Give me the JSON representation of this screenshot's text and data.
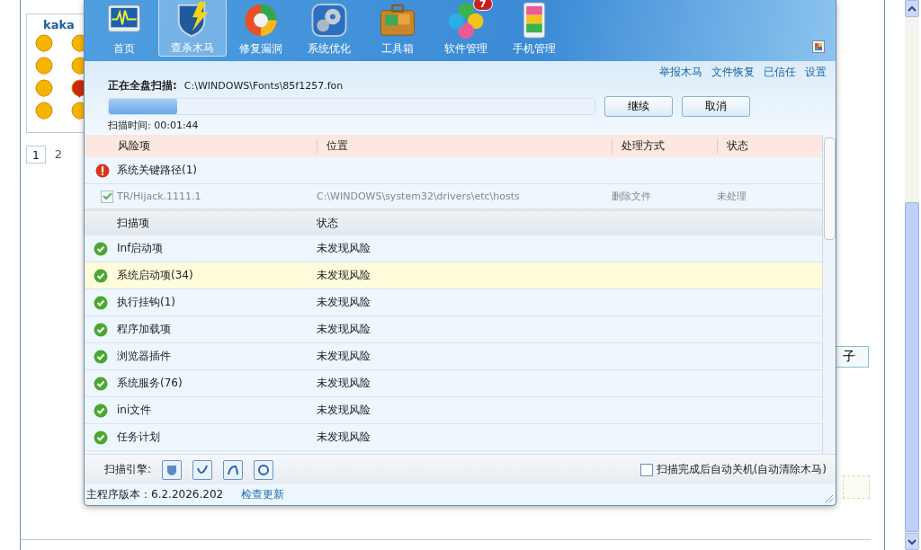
{
  "page": {
    "panel_title": "kaka",
    "pagination": [
      {
        "label": "1",
        "selected": true
      },
      {
        "label": "2",
        "selected": false
      }
    ],
    "side_button": "子"
  },
  "app": {
    "nav": [
      {
        "label": "首页",
        "selected": false
      },
      {
        "label": "查杀木马",
        "selected": true
      },
      {
        "label": "修复漏洞",
        "selected": false
      },
      {
        "label": "系统优化",
        "selected": false
      },
      {
        "label": "工具箱",
        "selected": false
      },
      {
        "label": "软件管理",
        "selected": false,
        "badge": "7"
      },
      {
        "label": "手机管理",
        "selected": false
      }
    ],
    "links": [
      "举报木马",
      "文件恢复",
      "已信任",
      "设置"
    ],
    "scan": {
      "label": "正在全盘扫描:",
      "path": "C:\\WINDOWS\\Fonts\\85f1257.fon",
      "level": 0.14,
      "time": "扫描时间: 00:01:44"
    },
    "buttons": [
      "继续",
      "取消"
    ],
    "risk_table": {
      "columns": [
        "风险项",
        "位置",
        "处理方式",
        "状态"
      ],
      "groups": [
        {
          "name": "系统关键路径(1)",
          "kind": "risk",
          "items": [
            {
              "name": "TR/Hijack.1111.1",
              "checked": true,
              "location": "C:\\WINDOWS\\system32\\drivers\\etc\\hosts",
              "action": "删除文件",
              "status": "未处理"
            }
          ]
        }
      ]
    },
    "scan_table": {
      "columns": [
        "扫描项",
        "状态"
      ],
      "rows": [
        {
          "name": "Inf启动项",
          "status": "未发现风险",
          "selected": false
        },
        {
          "name": "系统启动项(34)",
          "status": "未发现风险",
          "selected": true
        },
        {
          "name": "执行挂钩(1)",
          "status": "未发现风险",
          "selected": false
        },
        {
          "name": "程序加载项",
          "status": "未发现风险",
          "selected": false
        },
        {
          "name": "浏览器插件",
          "status": "未发现风险",
          "selected": false
        },
        {
          "name": "系统服务(76)",
          "status": "未发现风险",
          "selected": false
        },
        {
          "name": "ini文件",
          "status": "未发现风险",
          "selected": false
        },
        {
          "name": "任务计划",
          "status": "未发现风险",
          "selected": false
        }
      ]
    },
    "engine_label": "扫描引擎:",
    "auto_shutdown": {
      "label": "扫描完成后自动关机(自动清除木马)",
      "checked": false
    },
    "version": "主程序版本：6.2.2026.202",
    "update_link": "检查更新"
  }
}
